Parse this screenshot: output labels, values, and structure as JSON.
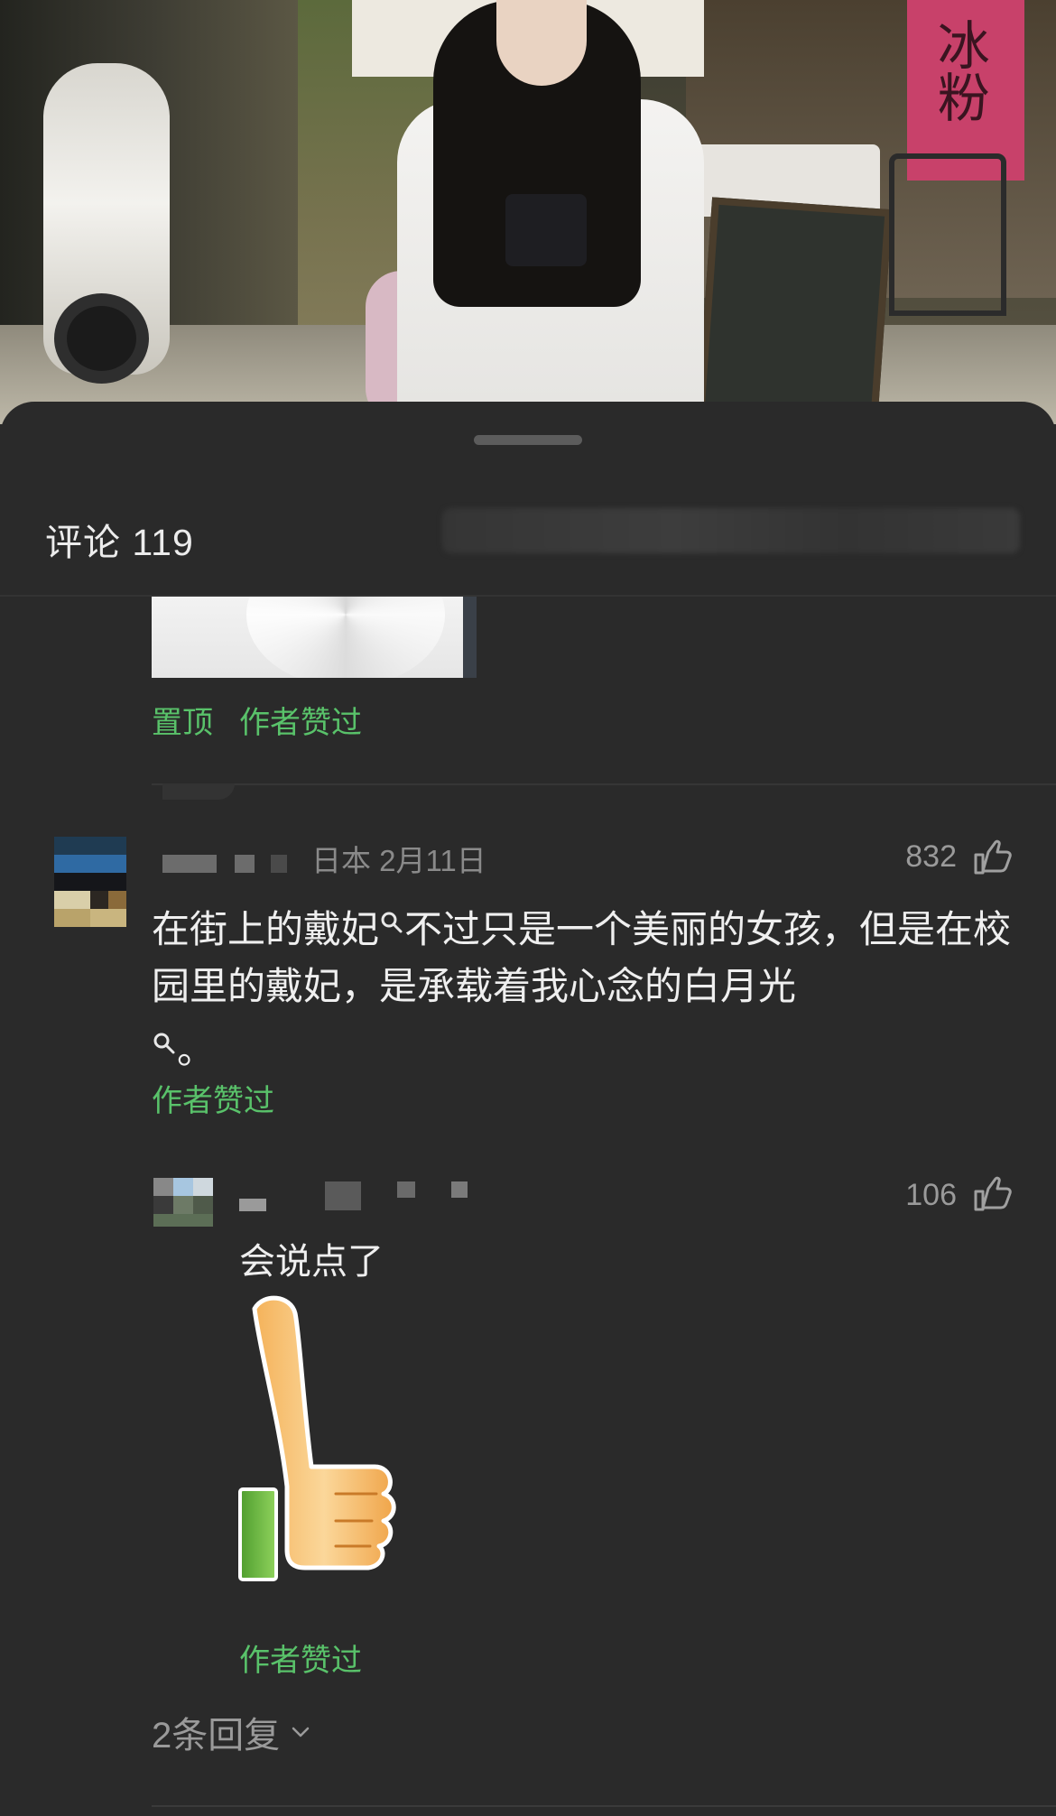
{
  "sheet": {
    "title": "评论 119"
  },
  "prior_comment": {
    "tags": [
      "置顶",
      "作者赞过"
    ]
  },
  "comment": {
    "meta": "日本 2月11日",
    "likes": "832",
    "text_part1": "在街上的戴妃",
    "text_part2": "不过只是一个美丽的女孩，但是在校园里的戴妃，是承载着我心念的白月光",
    "text_part3": "。",
    "tag": "作者赞过"
  },
  "reply": {
    "likes": "106",
    "text": "会说点了",
    "tag": "作者赞过"
  },
  "replies_link": "2条回复",
  "icons": {
    "like": "thumbs-up-outline-icon",
    "search": "search-icon",
    "chevron": "chevron-down-icon",
    "sticker": "thumbs-up-sticker-icon"
  },
  "colors": {
    "background": "#2a2a2a",
    "accent_green": "#59c26a",
    "text": "#efefef",
    "muted": "#8a8a8a"
  }
}
